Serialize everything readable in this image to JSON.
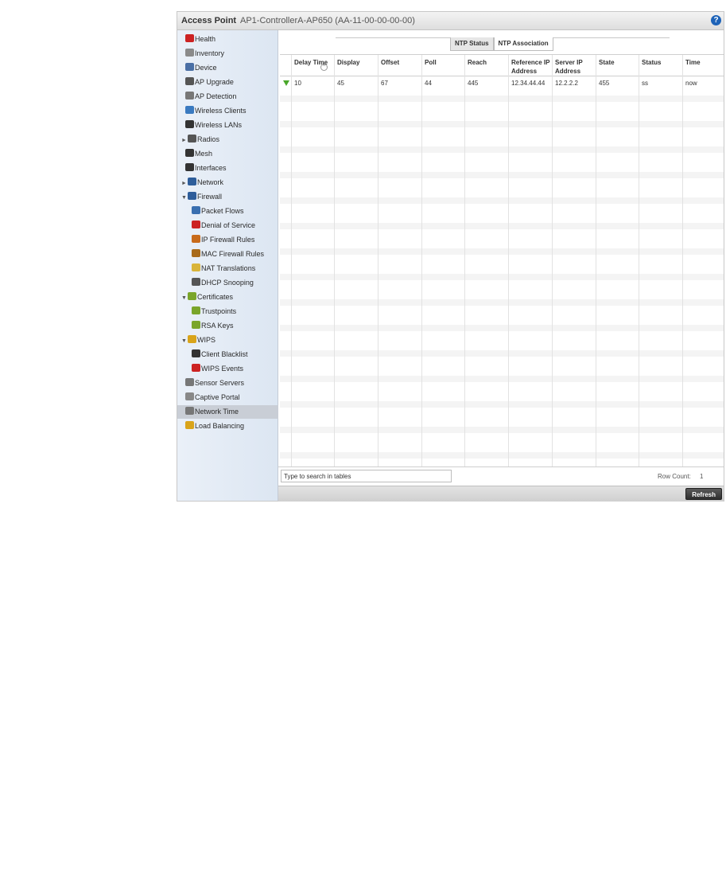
{
  "header": {
    "title": "Access Point",
    "device": "AP1-ControllerA-AP650 (AA-11-00-00-00-00)",
    "help": "?"
  },
  "sidebar": {
    "items": [
      {
        "label": "Health",
        "icon": "health-icon",
        "color": "#cc2222"
      },
      {
        "label": "Inventory",
        "icon": "inventory-icon",
        "color": "#8a8a8a"
      },
      {
        "label": "Device",
        "icon": "device-icon",
        "color": "#4a6fa5"
      },
      {
        "label": "AP Upgrade",
        "icon": "ap-upgrade-icon",
        "color": "#555555"
      },
      {
        "label": "AP Detection",
        "icon": "ap-detection-icon",
        "color": "#777777"
      },
      {
        "label": "Wireless Clients",
        "icon": "wireless-clients-icon",
        "color": "#3a7ac0"
      },
      {
        "label": "Wireless LANs",
        "icon": "wireless-lans-icon",
        "color": "#333333"
      },
      {
        "label": "Radios",
        "icon": "radio-icon",
        "color": "#555555"
      },
      {
        "label": "Mesh",
        "icon": "mesh-icon",
        "color": "#333333"
      },
      {
        "label": "Interfaces",
        "icon": "interfaces-icon",
        "color": "#333333"
      },
      {
        "label": "Network",
        "icon": "network-icon",
        "color": "#2e5d9a"
      },
      {
        "label": "Firewall",
        "icon": "firewall-icon",
        "color": "#2e5d9a"
      },
      {
        "label": "Packet Flows",
        "icon": "packet-flows-icon",
        "color": "#3a6fb0"
      },
      {
        "label": "Denial of Service",
        "icon": "denial-of-service-icon",
        "color": "#cc2222"
      },
      {
        "label": "IP Firewall Rules",
        "icon": "ip-firewall-icon",
        "color": "#c86a1a"
      },
      {
        "label": "MAC Firewall Rules",
        "icon": "mac-firewall-icon",
        "color": "#a86a1a"
      },
      {
        "label": "NAT Translations",
        "icon": "nat-icon",
        "color": "#d9b43a"
      },
      {
        "label": "DHCP Snooping",
        "icon": "dhcp-icon",
        "color": "#555555"
      },
      {
        "label": "Certificates",
        "icon": "certificates-icon",
        "color": "#7aa52a"
      },
      {
        "label": "Trustpoints",
        "icon": "trustpoints-icon",
        "color": "#7aa52a"
      },
      {
        "label": "RSA Keys",
        "icon": "rsa-keys-icon",
        "color": "#7aa52a"
      },
      {
        "label": "WIPS",
        "icon": "wips-icon",
        "color": "#d9a41a"
      },
      {
        "label": "Client Blacklist",
        "icon": "client-blacklist-icon",
        "color": "#333333"
      },
      {
        "label": "WIPS Events",
        "icon": "wips-events-icon",
        "color": "#cc2222"
      },
      {
        "label": "Sensor Servers",
        "icon": "sensor-servers-icon",
        "color": "#777777"
      },
      {
        "label": "Captive Portal",
        "icon": "captive-portal-icon",
        "color": "#888888"
      },
      {
        "label": "Network Time",
        "icon": "network-time-icon",
        "color": "#777777"
      },
      {
        "label": "Load Balancing",
        "icon": "load-balancing-icon",
        "color": "#d9a41a"
      }
    ]
  },
  "tabs": [
    "NTP Status",
    "NTP Association"
  ],
  "table": {
    "columns": [
      "Delay Time",
      "Display",
      "Offset",
      "Poll",
      "Reach",
      "Reference IP Address",
      "Server IP Address",
      "State",
      "Status",
      "Time"
    ],
    "rows": [
      [
        "10",
        "45",
        "67",
        "44",
        "445",
        "12.34.44.44",
        "12.2.2.2",
        "455",
        "ss",
        "now"
      ]
    ],
    "status_icon_color": "#4aa82a"
  },
  "search": {
    "placeholder": "Type to search in tables"
  },
  "row_count": {
    "label": "Row Count:",
    "value": "1"
  },
  "buttons": {
    "refresh": "Refresh"
  }
}
